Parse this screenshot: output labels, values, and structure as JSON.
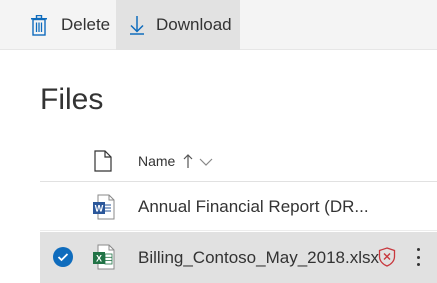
{
  "toolbar": {
    "delete_label": "Delete",
    "download_label": "Download"
  },
  "page": {
    "title": "Files"
  },
  "table": {
    "name_header": "Name"
  },
  "files": [
    {
      "name": "Annual Financial Report (DR...",
      "type": "word",
      "icon": "word-file-icon",
      "selected": false
    },
    {
      "name": "Billing_Contoso_May_2018.xlsx",
      "type": "excel",
      "icon": "excel-file-icon",
      "selected": true,
      "status_icon": "shield-warning-icon"
    }
  ],
  "colors": {
    "accent": "#0f6cbd",
    "word": "#2b579a",
    "excel": "#217346",
    "warning": "#c8383e",
    "selected_row": "#e1e1e1",
    "toolbar_bg": "#f4f4f4"
  }
}
